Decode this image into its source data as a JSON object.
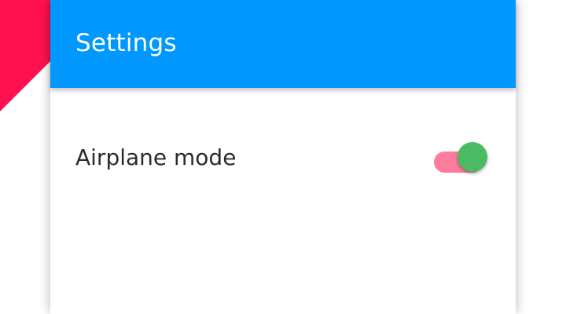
{
  "app_bar": {
    "title": "Settings",
    "background_color": "#0098ff"
  },
  "settings": {
    "items": [
      {
        "label": "Airplane mode",
        "toggle": {
          "checked": true,
          "track_color": "#ff1150",
          "thumb_color": "#4cb963"
        }
      }
    ]
  },
  "decoration": {
    "corner_color": "#ff1150"
  }
}
